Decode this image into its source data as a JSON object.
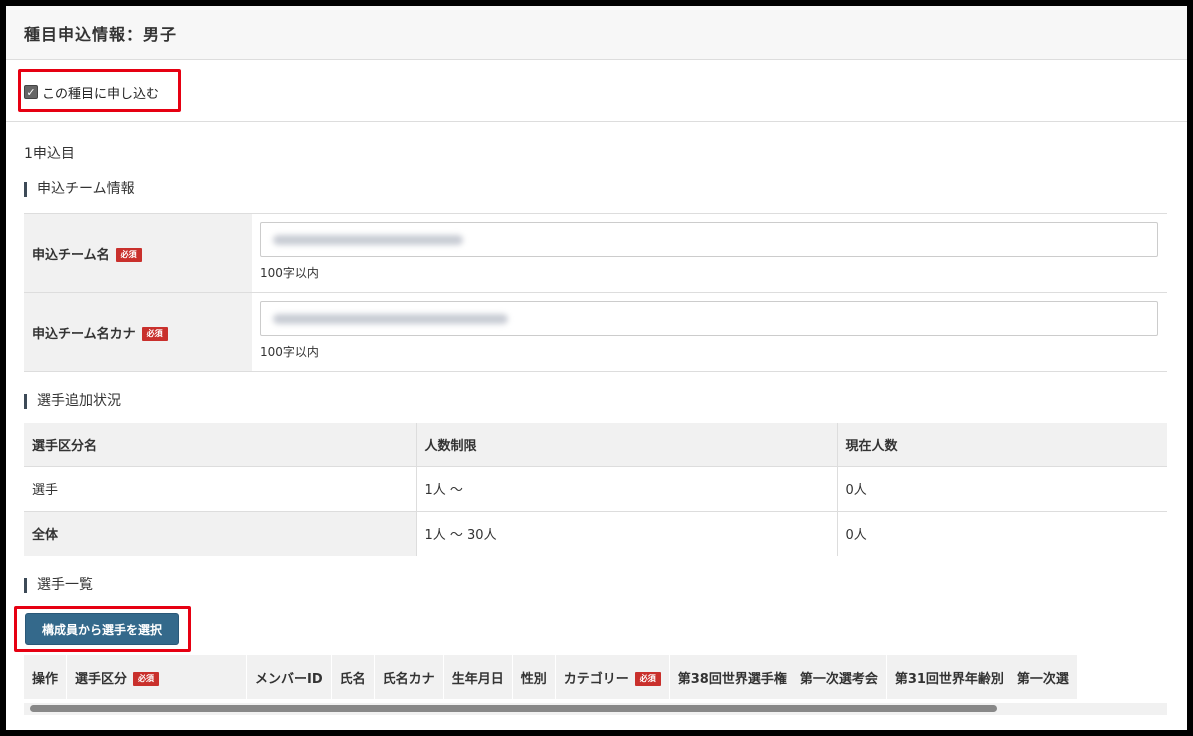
{
  "header": {
    "title": "種目申込情報：男子"
  },
  "apply_checkbox": {
    "checked": true,
    "label": "この種目に申し込む"
  },
  "entry": {
    "label": "1申込目"
  },
  "team_section": {
    "title": "申込チーム情報",
    "required_label": "必須",
    "rows": [
      {
        "label": "申込チーム名",
        "hint": "100字以内"
      },
      {
        "label": "申込チーム名カナ",
        "hint": "100字以内"
      }
    ]
  },
  "status_section": {
    "title": "選手追加状況",
    "headers": [
      "選手区分名",
      "人数制限",
      "現在人数"
    ],
    "rows": [
      [
        "選手",
        "1人 〜",
        "0人"
      ],
      [
        "全体",
        "1人 〜 30人",
        "0人"
      ]
    ]
  },
  "player_section": {
    "title": "選手一覧",
    "select_button": "構成員から選手を選択",
    "headers": [
      "操作",
      "選手区分",
      "メンバーID",
      "氏名",
      "氏名カナ",
      "生年月日",
      "性別",
      "カテゴリー",
      "第38回世界選手権　第一次選考会",
      "第31回世界年齢別　第一次選"
    ]
  },
  "colors": {
    "accent_button": "#34698b",
    "required_badge": "#c9302c",
    "highlight_box": "#e60012"
  }
}
